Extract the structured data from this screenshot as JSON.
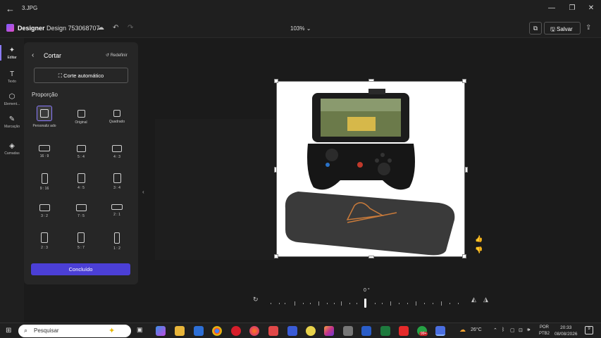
{
  "titlebar": {
    "filename": "3.JPG"
  },
  "appbar": {
    "brand": "Designer",
    "doc_name": "Design 753068707",
    "zoom": "103%",
    "save_label": "Salvar"
  },
  "rail": {
    "items": [
      {
        "label": "Editar",
        "icon": "sparkle-icon"
      },
      {
        "label": "Texto",
        "icon": "text-icon"
      },
      {
        "label": "Element...",
        "icon": "elements-icon"
      },
      {
        "label": "Marcação",
        "icon": "pen-icon"
      },
      {
        "label": "Camadas",
        "icon": "layers-icon"
      }
    ]
  },
  "panel": {
    "title": "Cortar",
    "reset_label": "Redefinir",
    "auto_crop_label": "Corte automático",
    "section_label": "Proporção",
    "options": [
      {
        "label": "Personaliz ado"
      },
      {
        "label": "Original"
      },
      {
        "label": "Quadrado"
      },
      {
        "label": "16 : 9"
      },
      {
        "label": "5 : 4"
      },
      {
        "label": "4 : 3"
      },
      {
        "label": "9 : 16"
      },
      {
        "label": "4 : 5"
      },
      {
        "label": "3 : 4"
      },
      {
        "label": "3 : 2"
      },
      {
        "label": "7 : 5"
      },
      {
        "label": "2 : 1"
      },
      {
        "label": "2 : 3"
      },
      {
        "label": "5 : 7"
      },
      {
        "label": "1 : 2"
      }
    ],
    "done_label": "Concluído"
  },
  "canvas": {
    "angle": "0 °"
  },
  "taskbar": {
    "search_placeholder": "Pesquisar",
    "weather": "26°C",
    "lang_top": "POR",
    "lang_bottom": "PTB2",
    "time": "20:33",
    "date": "08/08/2026",
    "badge": "99+",
    "notif_count": "9"
  }
}
